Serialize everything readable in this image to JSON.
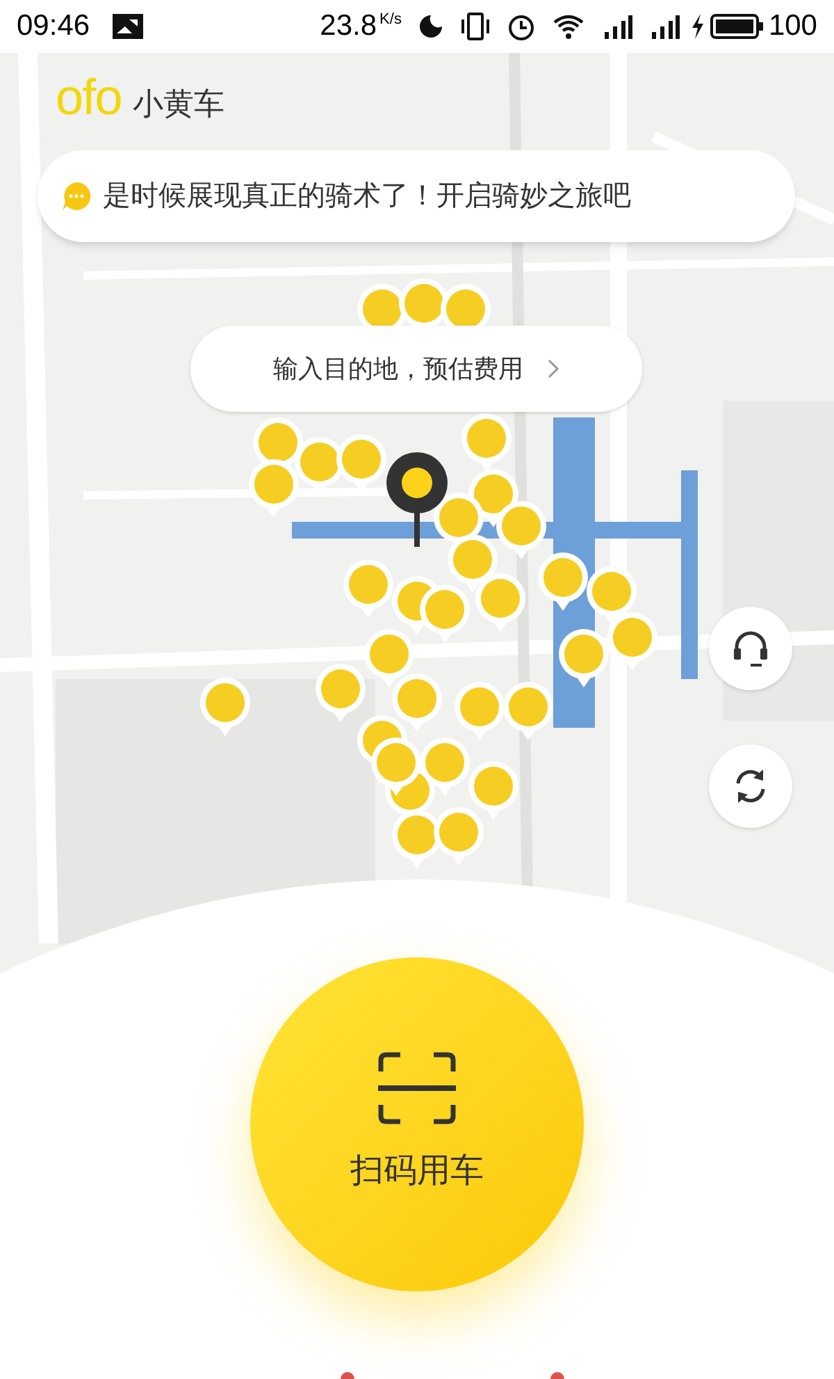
{
  "status_bar": {
    "time": "09:46",
    "speed": "23.8",
    "speed_unit": "K/s",
    "battery": "100"
  },
  "header": {
    "logo": "ofo",
    "title": "小黄车"
  },
  "banner": {
    "text": "是时候展现真正的骑术了！开启骑妙之旅吧"
  },
  "destination_prompt": {
    "text": "输入目的地，预估费用"
  },
  "scan_button": {
    "label": "扫码用车"
  }
}
